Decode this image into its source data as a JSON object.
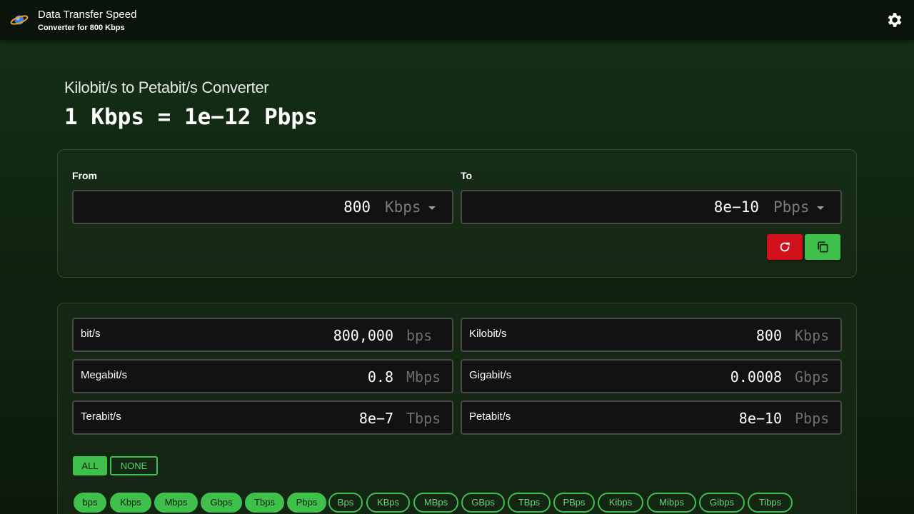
{
  "header": {
    "title": "Data Transfer Speed",
    "subtitle": "Converter for 800 Kbps"
  },
  "page": {
    "heading": "Kilobit/s to Petabit/s Converter",
    "formula": "1 Kbps = 1e−12 Pbps"
  },
  "converter": {
    "from_label": "From",
    "to_label": "To",
    "from_value": "800",
    "from_unit": "Kbps",
    "to_value": "8e−10",
    "to_unit": "Pbps"
  },
  "results": [
    {
      "name": "bit/s",
      "value": "800,000",
      "unit": "bps"
    },
    {
      "name": "Kilobit/s",
      "value": "800",
      "unit": "Kbps"
    },
    {
      "name": "Megabit/s",
      "value": "0.8",
      "unit": "Mbps"
    },
    {
      "name": "Gigabit/s",
      "value": "0.0008",
      "unit": "Gbps"
    },
    {
      "name": "Terabit/s",
      "value": "8e−7",
      "unit": "Tbps"
    },
    {
      "name": "Petabit/s",
      "value": "8e−10",
      "unit": "Pbps"
    }
  ],
  "filters": {
    "all_label": "ALL",
    "none_label": "NONE"
  },
  "chips": [
    {
      "label": "bps",
      "selected": true
    },
    {
      "label": "Kbps",
      "selected": true
    },
    {
      "label": "Mbps",
      "selected": true
    },
    {
      "label": "Gbps",
      "selected": true
    },
    {
      "label": "Tbps",
      "selected": true
    },
    {
      "label": "Pbps",
      "selected": true
    },
    {
      "label": "Bps",
      "selected": false
    },
    {
      "label": "KBps",
      "selected": false
    },
    {
      "label": "MBps",
      "selected": false
    },
    {
      "label": "GBps",
      "selected": false
    },
    {
      "label": "TBps",
      "selected": false
    },
    {
      "label": "PBps",
      "selected": false
    },
    {
      "label": "Kibps",
      "selected": false
    },
    {
      "label": "Mibps",
      "selected": false
    },
    {
      "label": "Gibps",
      "selected": false
    },
    {
      "label": "Tibps",
      "selected": false
    }
  ],
  "colors": {
    "accent_green": "#3ec04a",
    "reset_red": "#d0101a",
    "background": "#102410"
  },
  "icons": {
    "logo": "planet-logo-icon",
    "settings": "gear-icon",
    "reset": "refresh-icon",
    "copy": "copy-icon",
    "dropdown": "caret-down-icon"
  }
}
